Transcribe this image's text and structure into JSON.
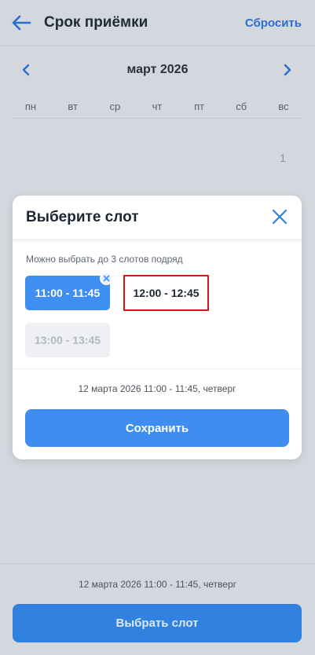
{
  "header": {
    "title": "Срок приёмки",
    "reset_label": "Сбросить"
  },
  "calendar": {
    "month_label": "март 2026",
    "weekdays": [
      "пн",
      "вт",
      "ср",
      "чт",
      "пт",
      "сб",
      "вс"
    ],
    "visible_days": [
      "1"
    ]
  },
  "modal": {
    "title": "Выберите слот",
    "hint": "Можно выбрать до 3 слотов подряд",
    "slots": [
      {
        "label": "11:00 - 11:45",
        "state": "selected"
      },
      {
        "label": "12:00 - 12:45",
        "state": "available"
      },
      {
        "label": "13:00 - 13:45",
        "state": "disabled"
      }
    ],
    "summary": "12 марта 2026 11:00 - 11:45, четверг",
    "save_label": "Сохранить"
  },
  "footer": {
    "summary": "12 марта 2026 11:00 - 11:45, четверг",
    "choose_label": "Выбрать слот"
  },
  "colors": {
    "accent": "#3e8ef2",
    "highlight_border": "#d51414",
    "overlay_background": "#d4d8de"
  }
}
